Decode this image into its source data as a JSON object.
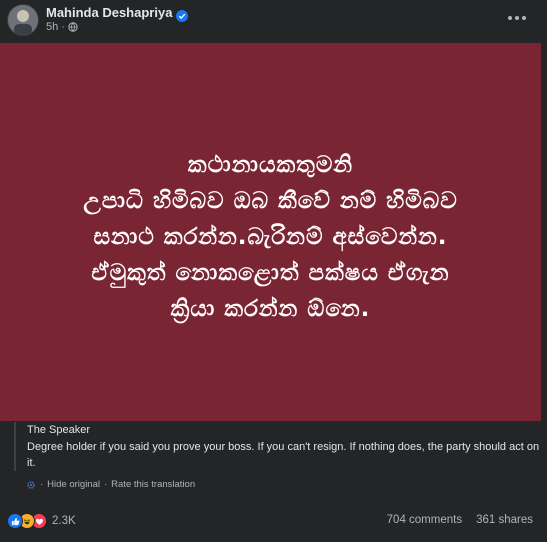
{
  "post": {
    "author": "Mahinda Deshapriya",
    "timestamp": "5h",
    "separator": "·",
    "verified_icon": "verified-badge-icon",
    "privacy_icon": "globe-icon",
    "more_icon": "more-options-icon"
  },
  "image": {
    "background_color": "#7a2533",
    "text": "කථානායකතුමනි\nඋපාධි හිමිබව ඔබ කීවේ නම් හිමිබව\nසනාථ කරන්න.බැරිනම් අස්වෙන්න.\nඒමුකුත් නොකළොත් පක්ෂය ඒගැන\nක්‍රියා කරන්න ඕනෙ."
  },
  "translation": {
    "title": "The Speaker",
    "text": "Degree holder if you said you prove your boss. If you can't resign. If nothing does, the party should act on it.",
    "hide_label": "Hide original",
    "rate_label": "Rate this translation",
    "link_separator": "·"
  },
  "engagement": {
    "reaction_count": "2.3K",
    "comments": "704 comments",
    "shares": "361 shares",
    "reaction_icons": [
      "like-icon",
      "haha-icon",
      "love-icon"
    ]
  }
}
